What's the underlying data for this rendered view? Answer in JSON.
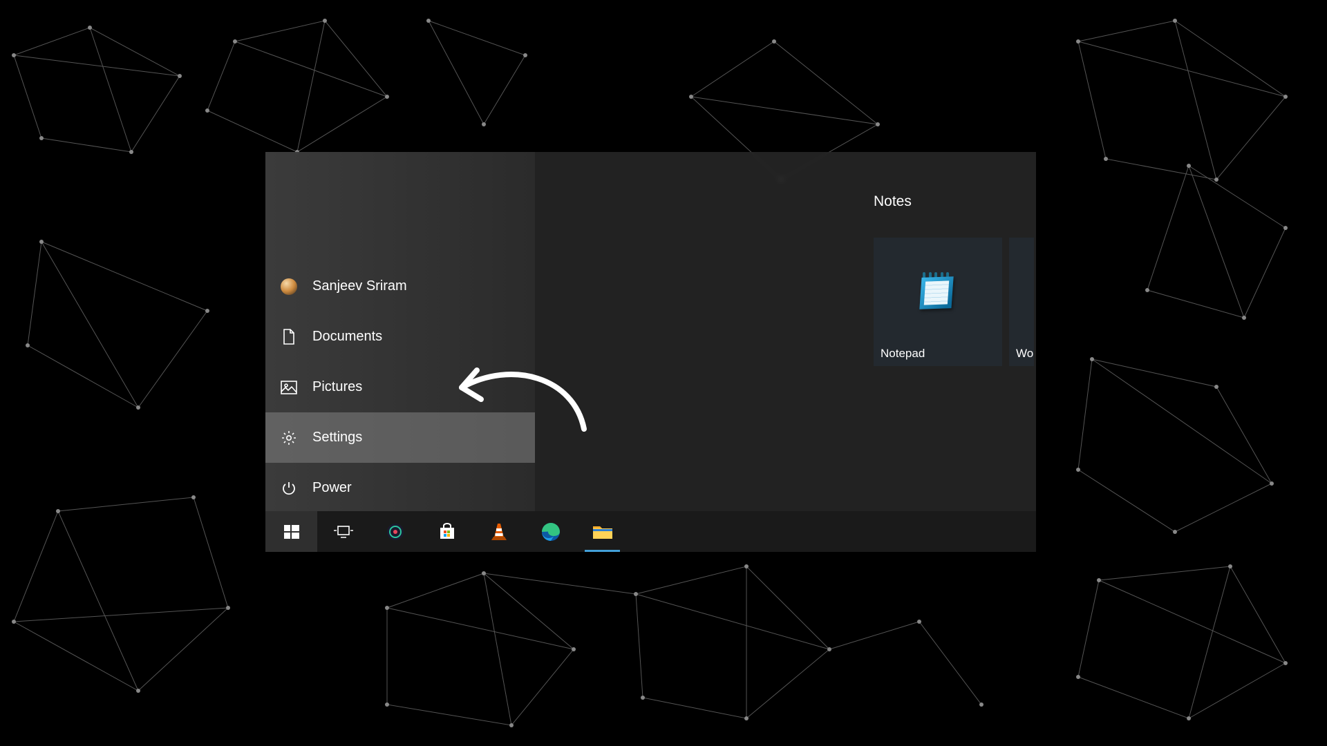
{
  "start_menu": {
    "rail": [
      {
        "name": "user-account",
        "label": "Sanjeev Sriram",
        "icon": "avatar",
        "highlight": false
      },
      {
        "name": "documents",
        "label": "Documents",
        "icon": "document",
        "highlight": false
      },
      {
        "name": "pictures",
        "label": "Pictures",
        "icon": "picture",
        "highlight": false
      },
      {
        "name": "settings",
        "label": "Settings",
        "icon": "gear",
        "highlight": true
      },
      {
        "name": "power",
        "label": "Power",
        "icon": "power",
        "highlight": false
      }
    ],
    "tiles_header": "Notes",
    "tiles": [
      {
        "name": "notepad-tile",
        "label": "Notepad",
        "icon": "notepad"
      },
      {
        "name": "wordpad-tile-clipped",
        "label": "Wo",
        "icon": "none"
      }
    ]
  },
  "taskbar": {
    "items": [
      {
        "name": "start-button",
        "icon": "windows",
        "active": true
      },
      {
        "name": "task-view-button",
        "icon": "taskview",
        "active": false
      },
      {
        "name": "saavn-app",
        "icon": "saavn",
        "active": false
      },
      {
        "name": "microsoft-store-app",
        "icon": "store",
        "active": false
      },
      {
        "name": "vlc-app",
        "icon": "vlc",
        "active": false
      },
      {
        "name": "edge-app",
        "icon": "edge",
        "active": false
      },
      {
        "name": "file-explorer-app",
        "icon": "explorer",
        "active": false,
        "underline": true
      }
    ]
  }
}
